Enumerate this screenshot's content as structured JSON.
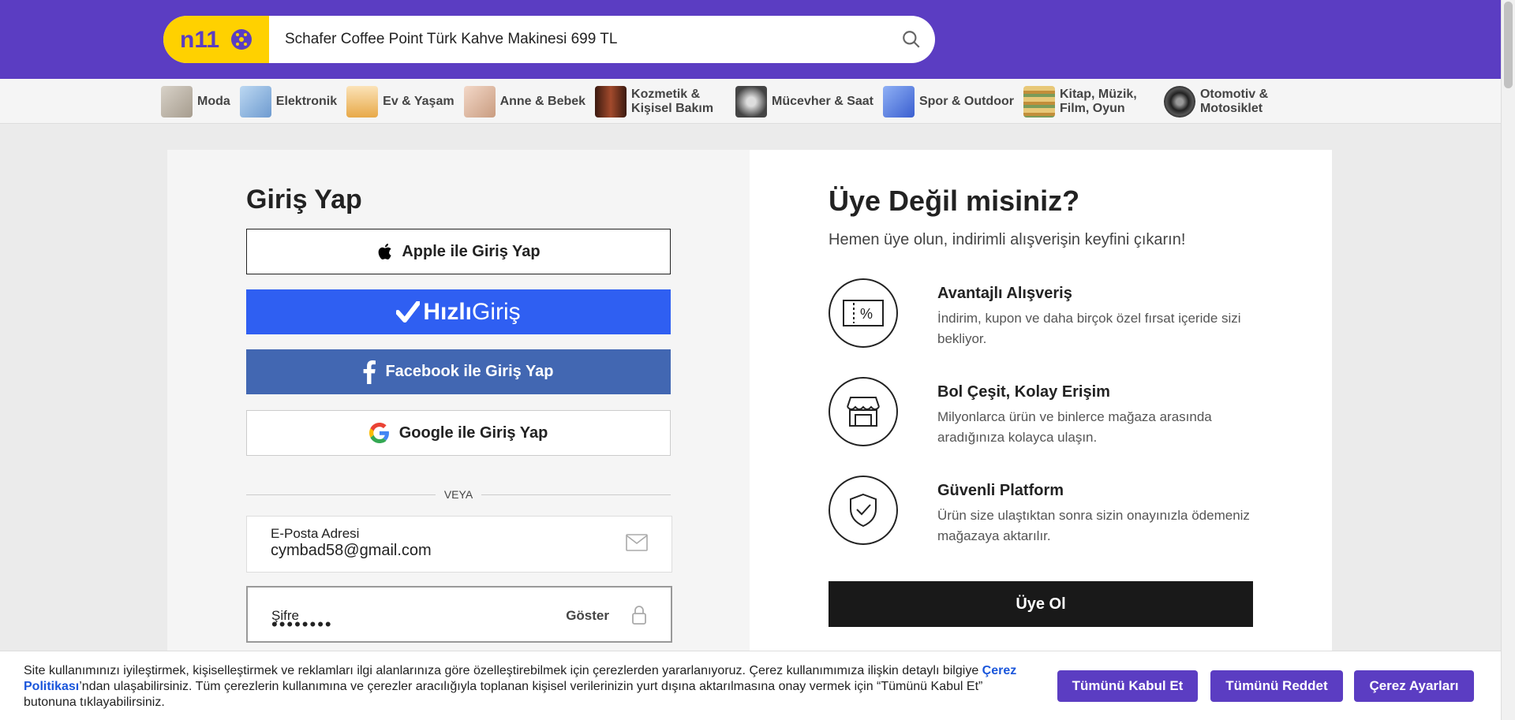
{
  "header": {
    "logo_text": "n11",
    "search_value": "Schafer Coffee Point Türk Kahve Makinesi 699 TL"
  },
  "categories": [
    {
      "label": "Moda",
      "color": "#c9c2b8"
    },
    {
      "label": "Elektronik",
      "color": "#9fc6ea"
    },
    {
      "label": "Ev & Yaşam",
      "color": "#f3c98a"
    },
    {
      "label": "Anne & Bebek",
      "color": "#e9c7b4"
    },
    {
      "label": "Kozmetik & Kişisel Bakım",
      "color": "#6a3020"
    },
    {
      "label": "Mücevher & Saat",
      "color": "#556"
    },
    {
      "label": "Spor & Outdoor",
      "color": "#6c8de6"
    },
    {
      "label": "Kitap, Müzik, Film, Oyun",
      "color": "#e1c278"
    },
    {
      "label": "Otomotiv & Motosiklet",
      "color": "#333"
    }
  ],
  "login": {
    "title": "Giriş Yap",
    "apple_label": "Apple ile Giriş Yap",
    "hizli_bold": "Hızlı",
    "hizli_light": "Giriş",
    "facebook_label": "Facebook ile Giriş Yap",
    "google_label": "Google ile Giriş Yap",
    "divider": "VEYA",
    "email_label": "E-Posta Adresi",
    "email_value": "cymbad58@gmail.com",
    "password_label": "Şifre",
    "password_value": "••••••••",
    "show_label": "Göster"
  },
  "register": {
    "title": "Üye Değil misiniz?",
    "subtitle": "Hemen üye olun, indirimli alışverişin keyfini çıkarın!",
    "benefits": [
      {
        "title": "Avantajlı Alışveriş",
        "desc": "İndirim, kupon ve daha birçok özel fırsat içeride sizi bekliyor."
      },
      {
        "title": "Bol Çeşit, Kolay Erişim",
        "desc": "Milyonlarca ürün ve binlerce mağaza arasında aradığınıza kolayca ulaşın."
      },
      {
        "title": "Güvenli Platform",
        "desc": "Ürün size ulaştıktan sonra sizin onayınızla ödemeniz mağazaya aktarılır."
      }
    ],
    "button": "Üye Ol"
  },
  "cookie": {
    "text_before": "Site kullanımınızı iyileştirmek, kişiselleştirmek ve reklamları ilgi alanlarınıza göre özelleştirebilmek için çerezlerden yararlanıyoruz. Çerez kullanımımıza ilişkin detaylı bilgiye ",
    "link": "Çerez Politikası",
    "text_after": "’ndan ulaşabilirsiniz. Tüm çerezlerin kullanımına ve çerezler aracılığıyla toplanan kişisel verilerinizin yurt dışına aktarılmasına onay vermek için “Tümünü Kabul Et” butonuna tıklayabilirsiniz.",
    "accept_all": "Tümünü Kabul Et",
    "reject_all": "Tümünü Reddet",
    "settings": "Çerez Ayarları"
  },
  "colors": {
    "brand_purple": "#5b3dc2",
    "brand_yellow": "#ffd100",
    "hizli_blue": "#2f5ff2",
    "facebook_blue": "#4267b2"
  }
}
